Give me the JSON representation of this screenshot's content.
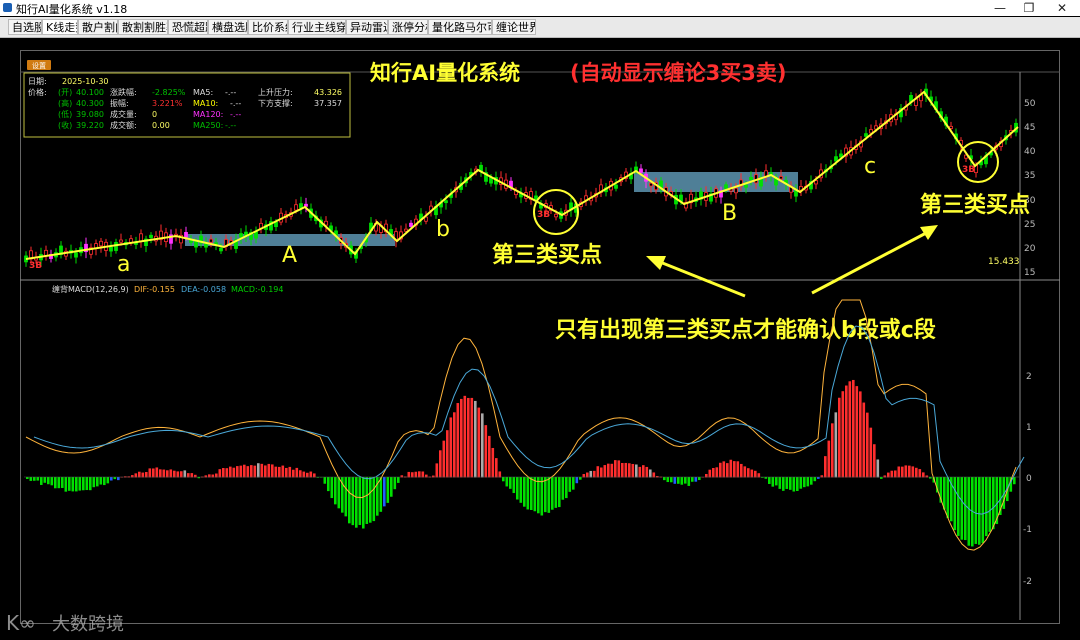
{
  "window": {
    "title": "知行AI量化系统 v1.18",
    "controls": [
      "minimize-icon",
      "restore-icon",
      "close-icon"
    ]
  },
  "tabs": [
    {
      "label": "自选股",
      "active": false
    },
    {
      "label": "K线走势",
      "active": true
    },
    {
      "label": "散户割肉",
      "active": false
    },
    {
      "label": "散割割胜率",
      "active": false
    },
    {
      "label": "恐慌超跌",
      "active": false
    },
    {
      "label": "横盘选股",
      "active": false
    },
    {
      "label": "比价系统",
      "active": false
    },
    {
      "label": "行业主线穿透",
      "active": false
    },
    {
      "label": "异动雷达",
      "active": false
    },
    {
      "label": "涨停分析",
      "active": false
    },
    {
      "label": "量化路马尔可夫",
      "active": false
    },
    {
      "label": "缠论世界",
      "active": false
    }
  ],
  "settings_button": "设置",
  "info_panel": {
    "date_label": "日期:",
    "date_value": "2025-10-30",
    "price_label": "价格:",
    "open_label": "(开)",
    "open_value": "40.100",
    "high_label": "(高)",
    "high_value": "40.300",
    "low_label": "(低)",
    "low_value": "39.080",
    "close_label": "(收)",
    "close_value": "39.220",
    "change_pct_label": "涨跌幅:",
    "change_pct_value": "-2.825%",
    "amplitude_label": "振幅:",
    "amplitude_value": "3.221%",
    "volume_label": "成交量:",
    "volume_value": "0",
    "turnover_label": "成交额:",
    "turnover_value": "0.00",
    "ma5_label": "MA5:",
    "ma5_value": "-.--",
    "ma10_label": "MA10:",
    "ma10_value": "-.--",
    "ma120_label": "MA120:",
    "ma120_value": "-.--",
    "ma250_label": "MA250:",
    "ma250_value": "-.--",
    "resistance_label": "上升压力:",
    "resistance_value": "43.326",
    "support_label": "下方支撑:",
    "support_value": "37.357"
  },
  "headline_main": "知行AI量化系统",
  "headline_sub": "(自动显示缠论3买3卖)",
  "price_axis": [
    "50",
    "45",
    "40",
    "35",
    "30",
    "25",
    "20",
    "15"
  ],
  "price_low_readout": "15.433",
  "annotations": {
    "seg_a": "a",
    "zone_A": "A",
    "seg_b": "b",
    "zone_B": "B",
    "seg_c": "c",
    "third_buy_1": "第三类买点",
    "third_buy_2": "第三类买点",
    "note": "只有出现第三类买点才能确认b段或c段",
    "marker_3b": "3B"
  },
  "macd_header": {
    "name": "缠背MACD(12,26,9)",
    "dif": "DIF:-0.155",
    "dea": "DEA:-0.058",
    "macd": "MACD:-0.194"
  },
  "macd_axis": [
    "2",
    "1",
    "0",
    "-1",
    "-2"
  ],
  "watermark": "大数跨境",
  "colors": {
    "up": "#ff2e2e",
    "down": "#00e000",
    "limit_up": "#ff33ff",
    "neutral": "#ffff66",
    "stroke": "#ffff33",
    "zone": "#4f7f97",
    "dif": "#ffb43c",
    "dea": "#4aa8d8",
    "text_red": "#ff3030",
    "hist_gray": "#aaaaaa",
    "hist_blue": "#2060ff"
  }
}
